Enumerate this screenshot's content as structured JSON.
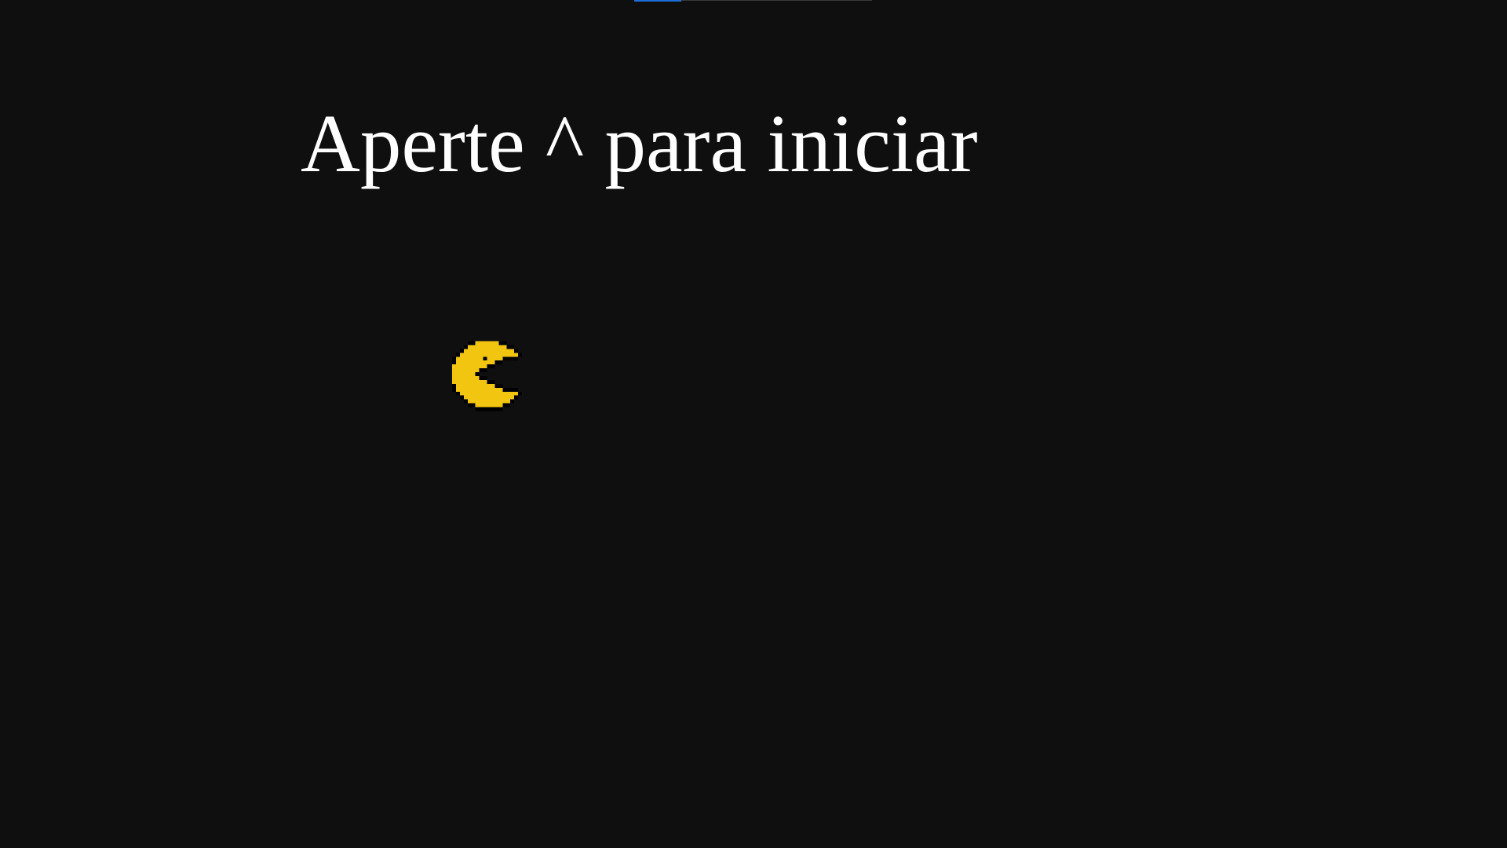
{
  "screen": {
    "background_color": "#0f0f0f"
  },
  "top_bar": {
    "accent_color": "#1e6fd9",
    "track_color": "#3a3a3a"
  },
  "prompt": {
    "text": "Aperte ^ para iniciar",
    "color": "#ffffff"
  },
  "player": {
    "icon": "pacman-icon",
    "color": "#f2c511",
    "outline_color": "#000000",
    "facing": "right"
  }
}
